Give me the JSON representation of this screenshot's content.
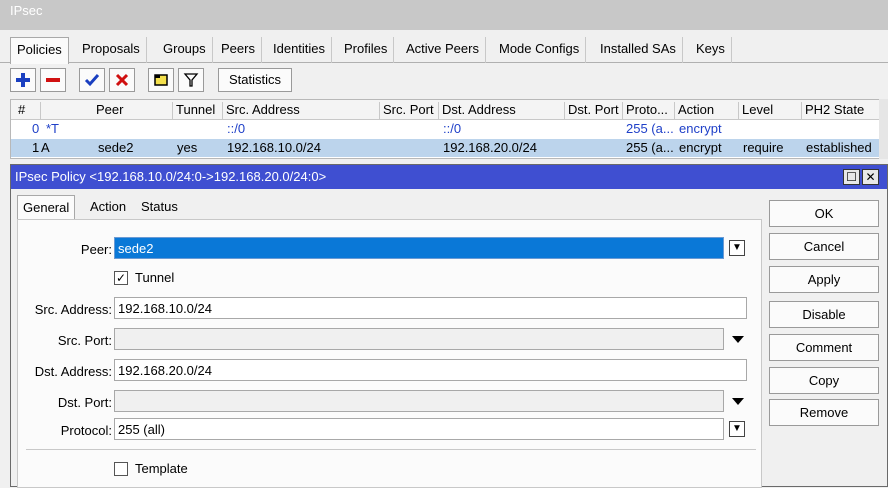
{
  "window": {
    "title": "IPsec"
  },
  "tabs": [
    "Policies",
    "Proposals",
    "Groups",
    "Peers",
    "Identities",
    "Profiles",
    "Active Peers",
    "Mode Configs",
    "Installed SAs",
    "Keys"
  ],
  "toolbar": {
    "statistics_label": "Statistics"
  },
  "table": {
    "headers": [
      "#",
      "Peer",
      "Tunnel",
      "Src. Address",
      "Src. Port",
      "Dst. Address",
      "Dst. Port",
      "Proto...",
      "Action",
      "Level",
      "PH2 State"
    ],
    "rows": [
      {
        "num": "0",
        "flags": "*T",
        "peer": "",
        "tunnel": "",
        "src": "::/0",
        "srcport": "",
        "dst": "::/0",
        "dstport": "",
        "proto": "255 (a...",
        "action": "encrypt",
        "level": "",
        "ph2": ""
      },
      {
        "num": "1",
        "flags": "A",
        "peer": "sede2",
        "tunnel": "yes",
        "src": "192.168.10.0/24",
        "srcport": "",
        "dst": "192.168.20.0/24",
        "dstport": "",
        "proto": "255 (a...",
        "action": "encrypt",
        "level": "require",
        "ph2": "established"
      }
    ]
  },
  "dialog": {
    "title": "IPsec Policy <192.168.10.0/24:0->192.168.20.0/24:0>",
    "tabs": [
      "General",
      "Action",
      "Status"
    ],
    "labels": {
      "peer": "Peer:",
      "tunnel": "Tunnel",
      "src_address": "Src. Address:",
      "src_port": "Src. Port:",
      "dst_address": "Dst. Address:",
      "dst_port": "Dst. Port:",
      "protocol": "Protocol:",
      "template": "Template"
    },
    "values": {
      "peer": "sede2",
      "tunnel_checked": "✓",
      "src_address": "192.168.10.0/24",
      "src_port": "",
      "dst_address": "192.168.20.0/24",
      "dst_port": "",
      "protocol": "255 (all)",
      "template_checked": ""
    },
    "buttons": [
      "OK",
      "Cancel",
      "Apply",
      "Disable",
      "Comment",
      "Copy",
      "Remove"
    ]
  },
  "colors": {
    "dialog_title_bg": "#3f4fd1",
    "selection": "#0a78d7",
    "row_selected": "#bcd4ec",
    "disabled_row_text": "#1f40c8"
  },
  "icons": [
    "add-icon",
    "remove-icon",
    "enable-check-icon",
    "disable-x-icon",
    "comment-icon",
    "filter-icon"
  ]
}
